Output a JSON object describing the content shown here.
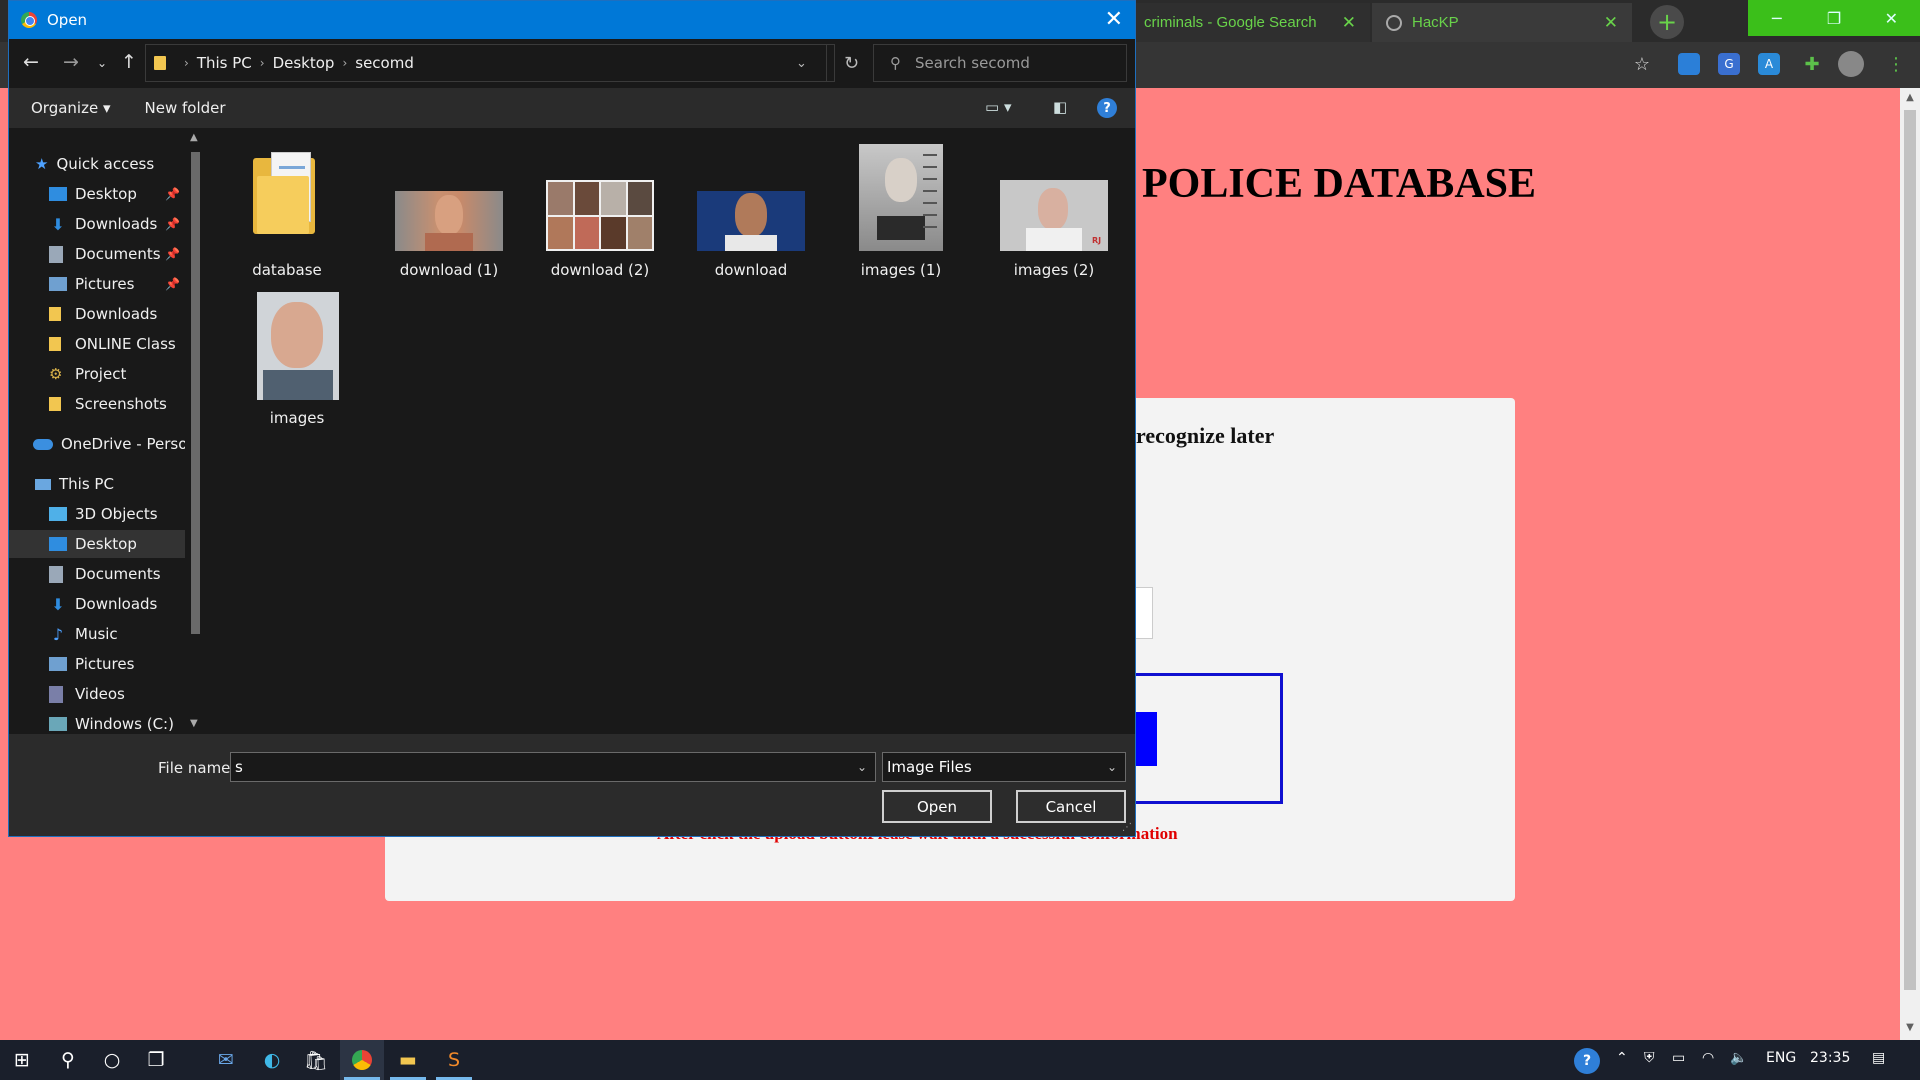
{
  "browser": {
    "tabs": [
      {
        "label": "criminals - Google Search",
        "close": "✕"
      },
      {
        "label": "HacKP",
        "close": "✕"
      }
    ],
    "new_tab": "+",
    "window_controls": {
      "minimize": "─",
      "restore": "❐",
      "close": "✕"
    }
  },
  "page": {
    "heading": "POLICE DATABASE",
    "card_text": "recognize later",
    "note": "After click the upload buttonPlease wait until a successful conformation",
    "colors": {
      "background": "#ff8080",
      "card": "#f3f3f3",
      "note": "#e00000",
      "button": "#0000ff"
    }
  },
  "dialog": {
    "title": "Open",
    "breadcrumb": [
      "This PC",
      "Desktop",
      "secomd"
    ],
    "search_placeholder": "Search secomd",
    "toolbar": {
      "organize": "Organize ▾",
      "new_folder": "New folder",
      "help": "?"
    },
    "nav": {
      "quick_access": "Quick access",
      "quick_items": [
        {
          "label": "Desktop",
          "pinned": true
        },
        {
          "label": "Downloads",
          "pinned": true
        },
        {
          "label": "Documents",
          "pinned": true
        },
        {
          "label": "Pictures",
          "pinned": true
        },
        {
          "label": "Downloads",
          "pinned": false
        },
        {
          "label": "ONLINE Class",
          "pinned": false
        },
        {
          "label": "Project",
          "pinned": false
        },
        {
          "label": "Screenshots",
          "pinned": false
        }
      ],
      "onedrive": "OneDrive - Person",
      "this_pc": "This PC",
      "pc_items": [
        "3D Objects",
        "Desktop",
        "Documents",
        "Downloads",
        "Music",
        "Pictures",
        "Videos",
        "Windows (C:)"
      ],
      "selected": "Desktop"
    },
    "files": [
      "database",
      "download (1)",
      "download (2)",
      "download",
      "images (1)",
      "images (2)",
      "images"
    ],
    "footer": {
      "file_name_label": "File name:",
      "file_name_value": "s",
      "file_type": "Image Files",
      "open": "Open",
      "cancel": "Cancel"
    }
  },
  "taskbar": {
    "lang": "ENG",
    "time": "23:35"
  }
}
